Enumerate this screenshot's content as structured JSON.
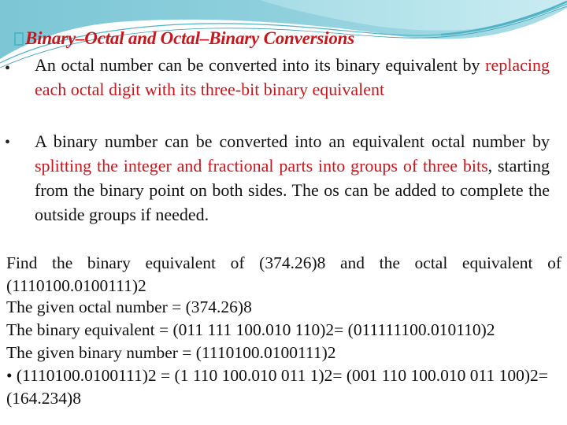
{
  "slide": {
    "title_icon": "checkbox-bullet-icon",
    "title": "Binary–Octal and Octal–Binary Conversions",
    "bullets": [
      {
        "text_before": "An octal number can be converted into its binary equivalent by ",
        "highlight": "replacing each octal digit with its three-bit binary equivalent",
        "text_after": ""
      },
      {
        "text_before": "A binary number can be converted into an equivalent octal number by ",
        "highlight": "splitting the integer and fractional parts into groups of three bits",
        "text_after": ", starting from the binary point on both sides. The os can be added to complete the outside groups if needed."
      }
    ],
    "question": "Find the binary equivalent of (374.26)8 and the octal equivalent of (1110100.0100111)2",
    "solution_lines": [
      "The given octal number = (374.26)8",
      "The binary equivalent = (011 111 100.010 110)2= (011111100.010110)2",
      "The given binary number = (1110100.0100111)2",
      "• (1110100.0100111)2 = (1 110 100.010 011 1)2= (001 110 100.010 011 100)2= (164.234)8"
    ],
    "colors": {
      "title": "#c8161d",
      "highlight": "#c8161d",
      "question": "#4a6b2a",
      "header_wave": "#6fc3d3"
    }
  }
}
